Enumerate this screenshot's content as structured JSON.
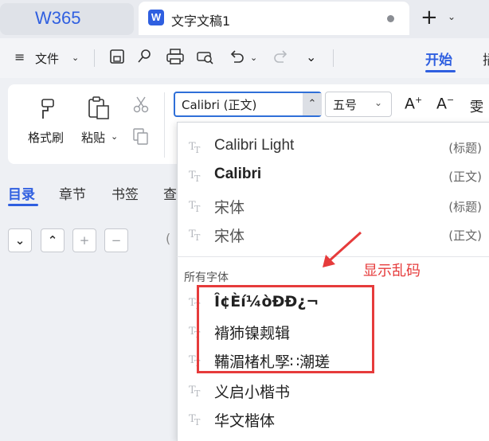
{
  "tabbar": {
    "logo": "W365",
    "doc_tab": {
      "icon_letter": "W",
      "title": "文字文稿1"
    },
    "new_tab": "+",
    "icons": [
      "word-icon",
      "unsaved-dot-icon",
      "plus-icon",
      "chevron-down-icon"
    ]
  },
  "toolbar": {
    "file_label": "文件",
    "icons": [
      "menu-icon",
      "save-icon",
      "export-icon",
      "print-icon",
      "print-preview-icon",
      "undo-icon",
      "redo-icon",
      "more-icon"
    ],
    "tabs": [
      {
        "label": "开始",
        "active": true
      },
      {
        "label": "插",
        "active": false
      }
    ]
  },
  "ribbon": {
    "format_painter": "格式刷",
    "paste": "粘贴",
    "font": {
      "value": "Calibri (正文)"
    },
    "font_size": {
      "value": "五号"
    },
    "icons": [
      "format-painter-icon",
      "paste-icon",
      "cut-icon",
      "copy-icon",
      "increase-font-icon",
      "decrease-font-icon",
      "phonetic-guide-icon"
    ]
  },
  "nav_pane": {
    "tabs": [
      {
        "label": "目录",
        "active": true
      },
      {
        "label": "章节",
        "active": false
      },
      {
        "label": "书签",
        "active": false
      },
      {
        "label": "查",
        "active": false
      }
    ],
    "buttons": [
      "chevron-down-icon",
      "chevron-up-icon",
      "plus-icon",
      "minus-icon"
    ]
  },
  "font_dropdown": {
    "recent": [
      {
        "name": "Calibri Light",
        "tag": "(标题)",
        "bold": false
      },
      {
        "name": "Calibri",
        "tag": "(正文)",
        "bold": true
      },
      {
        "name": "宋体",
        "tag": "(标题)",
        "bold": false
      },
      {
        "name": "宋体",
        "tag": "(正文)",
        "bold": false
      }
    ],
    "section_label": "所有字体",
    "all_fonts": [
      {
        "name": "Î¢Èí¼òÐÐ¿¬",
        "garbled": true
      },
      {
        "name": "褙犻镍觌辑",
        "garbled": true
      },
      {
        "name": "鞴湄楮札孯∷潮瑳",
        "garbled": true
      },
      {
        "name": "义启小楷书",
        "garbled": false
      },
      {
        "name": "华文楷体",
        "garbled": false
      }
    ]
  },
  "annotation": {
    "text": "显示乱码",
    "color": "#e63b3b"
  },
  "colors": {
    "accent": "#2f5fe0",
    "annotation": "#e63b3b"
  }
}
